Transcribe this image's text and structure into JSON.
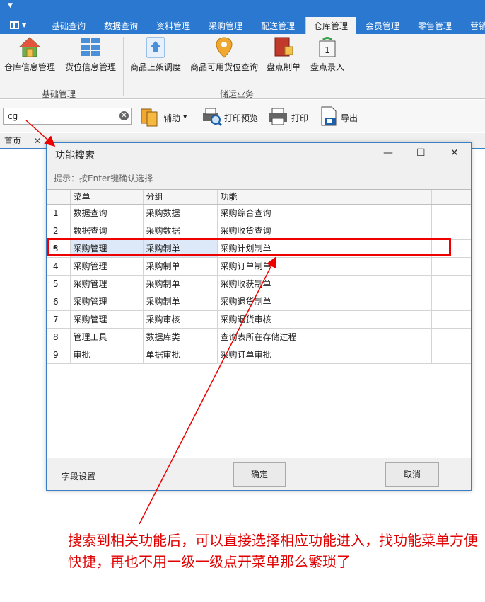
{
  "menu": {
    "tabs": [
      "基础查询",
      "数据查询",
      "资料管理",
      "采购管理",
      "配送管理",
      "仓库管理",
      "会员管理",
      "零售管理",
      "营销"
    ],
    "active_tab": "仓库管理"
  },
  "ribbon": {
    "groups": [
      {
        "label": "基础管理",
        "buttons": [
          "仓库信息管理",
          "货位信息管理"
        ]
      },
      {
        "label": "储运业务",
        "buttons": [
          "商品上架调度",
          "商品可用货位查询",
          "盘点制单",
          "盘点录入"
        ]
      }
    ]
  },
  "toolbar": {
    "search_value": "cg",
    "assist_label": "辅助",
    "print_preview_label": "打印预览",
    "print_label": "打印",
    "export_label": "导出"
  },
  "doc_tabs": [
    {
      "label": "首页"
    }
  ],
  "dialog": {
    "title": "功能搜索",
    "hint": "提示：按Enter键确认选择",
    "columns": [
      "菜单",
      "分组",
      "功能"
    ],
    "rows": [
      {
        "idx": "1",
        "menu": "数据查询",
        "group": "采购数据",
        "func": "采购综合查询"
      },
      {
        "idx": "2",
        "menu": "数据查询",
        "group": "采购数据",
        "func": "采购收货查询"
      },
      {
        "idx": "3",
        "menu": "采购管理",
        "group": "采购制单",
        "func": "采购计划制单"
      },
      {
        "idx": "4",
        "menu": "采购管理",
        "group": "采购制单",
        "func": "采购订单制单"
      },
      {
        "idx": "5",
        "menu": "采购管理",
        "group": "采购制单",
        "func": "采购收获制单"
      },
      {
        "idx": "6",
        "menu": "采购管理",
        "group": "采购制单",
        "func": "采购退货制单"
      },
      {
        "idx": "7",
        "menu": "采购管理",
        "group": "采购审核",
        "func": "采购退货审核"
      },
      {
        "idx": "8",
        "menu": "管理工具",
        "group": "数据库类",
        "func": "查询表所在存储过程"
      },
      {
        "idx": "9",
        "menu": "审批",
        "group": "单据审批",
        "func": "采购订单审批"
      }
    ],
    "selected_index": 2,
    "field_settings_label": "字段设置",
    "ok_label": "确定",
    "cancel_label": "取消"
  },
  "annotation": {
    "text": "搜索到相关功能后，可以直接选择相应功能进入，找功能菜单方便快捷，再也不用一级一级点开菜单那么繁琐了",
    "color": "#e00000"
  },
  "colors": {
    "accent": "#2b78d0",
    "highlight": "#ee0000"
  }
}
